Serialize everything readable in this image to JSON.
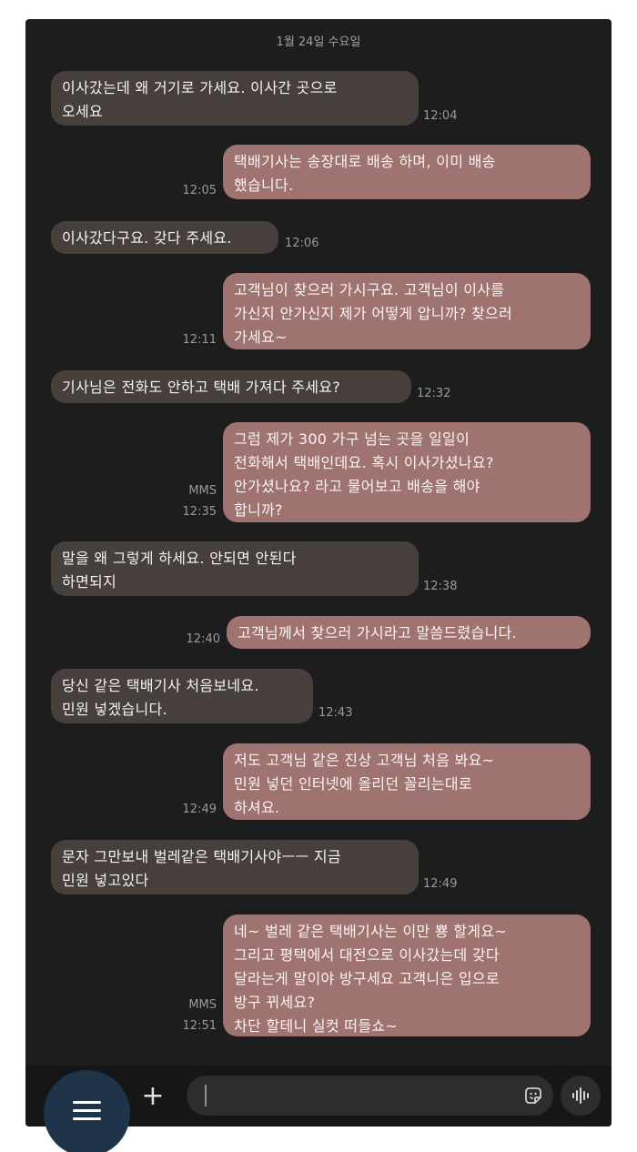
{
  "date_separator": "1월 24일 수요일",
  "messages": [
    {
      "dir": "in",
      "text": "이사갔는데 왜 거기로 가세요. 이사간 곳으로\n오세요",
      "time": "12:04",
      "mms": ""
    },
    {
      "dir": "out",
      "text": "택배기사는 송장대로 배송 하며, 이미 배송\n했습니다.",
      "time": "12:05",
      "mms": ""
    },
    {
      "dir": "in",
      "text": "이사갔다구요. 갖다 주세요.",
      "time": "12:06",
      "mms": ""
    },
    {
      "dir": "out",
      "text": "고객님이 찾으러 가시구요. 고객님이 이사를\n가신지 안가신지 제가 어떻게 압니까? 찾으러\n가세요~",
      "time": "12:11",
      "mms": ""
    },
    {
      "dir": "in",
      "text": "기사님은 전화도 안하고 택배 가져다 주세요?",
      "time": "12:32",
      "mms": ""
    },
    {
      "dir": "out",
      "text": "그럼 제가 300 가구 넘는 곳을 일일이\n전화해서 택배인데요. 혹시 이사가셨나요?\n안가셨나요? 라고 물어보고 배송을 해야\n합니까?",
      "time": "12:35",
      "mms": "MMS"
    },
    {
      "dir": "in",
      "text": "말을 왜 그렇게 하세요. 안되면 안된다\n하면되지",
      "time": "12:38",
      "mms": ""
    },
    {
      "dir": "out",
      "text": "고객님께서 찾으러 가시라고 말씀드렸습니다.",
      "time": "12:40",
      "mms": ""
    },
    {
      "dir": "in",
      "text": "당신 같은 택배기사 처음보네요.\n민원 넣겠습니다.",
      "time": "12:43",
      "mms": ""
    },
    {
      "dir": "out",
      "text": "저도 고객님 같은 진상 고객님 처음 봐요~\n민원 넣던 인터넷에 올리던 꼴리는대로\n하셔요.",
      "time": "12:49",
      "mms": ""
    },
    {
      "dir": "in",
      "text": "문자 그만보내 벌레같은 택배기사야ㅡㅡ 지금\n민원 넣고있다",
      "time": "12:49",
      "mms": ""
    },
    {
      "dir": "out",
      "text": "네~ 벌레 같은 택배기사는 이만 뿅 할게요~\n그리고 평택에서 대전으로 이사갔는데 갖다\n달라는게 말이야 방구세요 고객니은 입으로\n방구 뀌세요?\n차단 할테니 실컷 떠들쇼~",
      "time": "12:51",
      "mms": "MMS"
    }
  ],
  "composer": {
    "placeholder": "",
    "plus_icon": "plus-icon",
    "sticker_icon": "sticker-icon",
    "voice_icon": "voice-wave-icon"
  },
  "fab": {
    "icon": "hamburger-menu-icon"
  },
  "colors": {
    "background": "#1d1d1d",
    "incoming_bubble": "#473f3c",
    "outgoing_bubble": "#9f7470",
    "fab": "#1e3448"
  }
}
